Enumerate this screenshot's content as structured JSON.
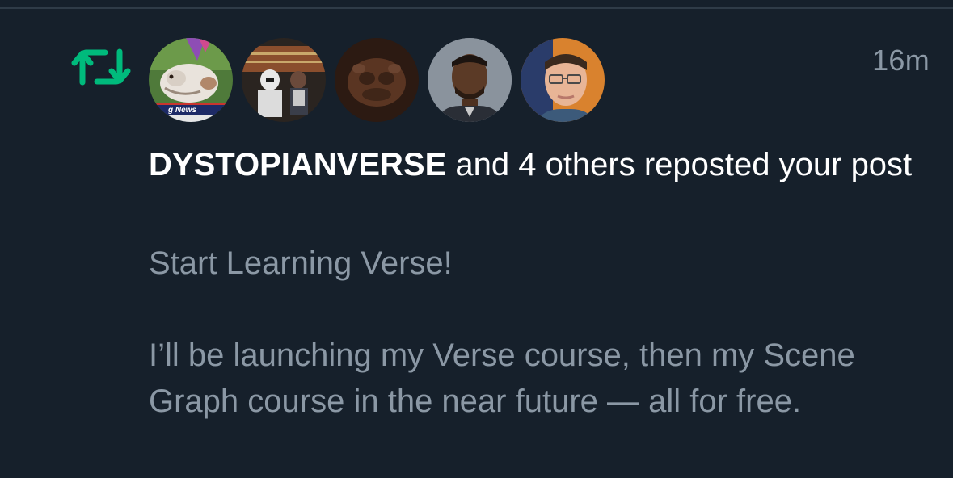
{
  "notification": {
    "type_icon": "repost-icon",
    "accent_color": "#00ba7c",
    "timestamp": "16m",
    "actor_name": "DYSTOPIANVERSE",
    "action_text": " and 4 others reposted your post",
    "avatars": [
      {
        "icon": "cat-news-avatar"
      },
      {
        "icon": "stormtroopers-avatar"
      },
      {
        "icon": "creature-avatar"
      },
      {
        "icon": "man-portrait-avatar"
      },
      {
        "icon": "man-glasses-avatar"
      }
    ]
  },
  "post": {
    "title": "Start Learning Verse!",
    "body": "I’ll be launching my Verse course, then my Scene Graph course in the near future — all for free."
  },
  "colors": {
    "background": "#16202b",
    "primary_text": "#ffffff",
    "secondary_text": "#8b98a5",
    "divider": "#2f3b47"
  }
}
